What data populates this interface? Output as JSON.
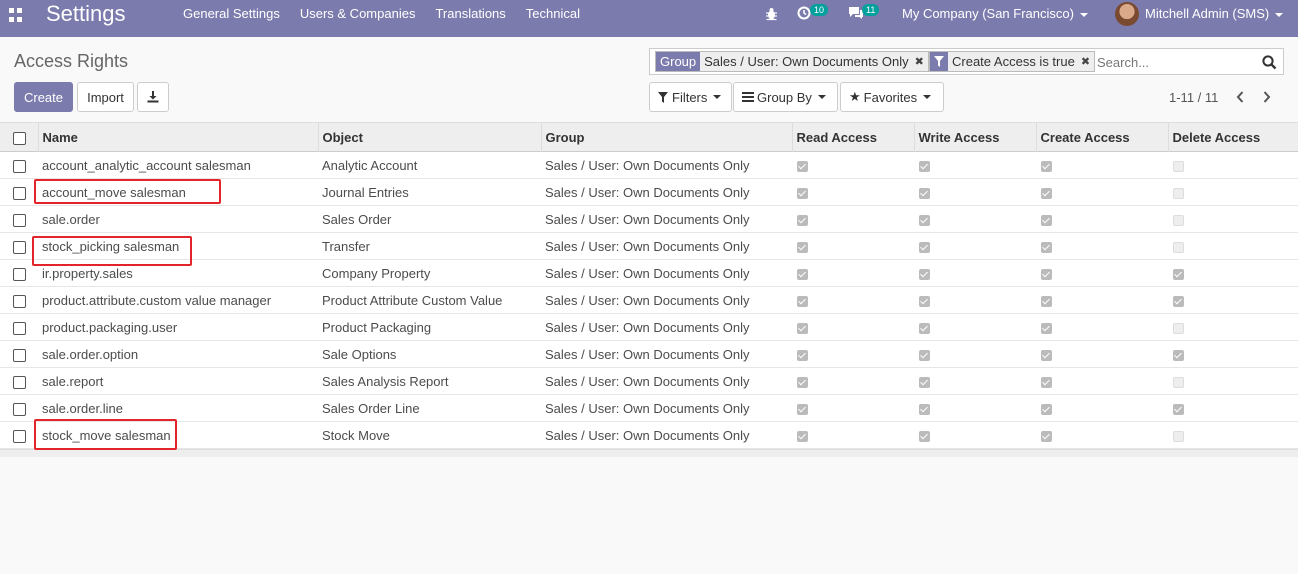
{
  "navbar": {
    "app_title": "Settings",
    "menu": [
      "General Settings",
      "Users & Companies",
      "Translations",
      "Technical"
    ],
    "activity_count": "10",
    "messages_count": "11",
    "company": "My Company (San Francisco)",
    "user": "Mitchell Admin (SMS)"
  },
  "control": {
    "breadcrumb": "Access Rights",
    "create_label": "Create",
    "import_label": "Import",
    "filters_label": "Filters",
    "groupby_label": "Group By",
    "favorites_label": "Favorites",
    "pager": "1-11 / 11"
  },
  "search": {
    "facet1_label": "Group",
    "facet1_value": "Sales / User: Own Documents Only",
    "facet2_value": "Create Access is true",
    "placeholder": "Search..."
  },
  "table": {
    "columns": [
      "Name",
      "Object",
      "Group",
      "Read Access",
      "Write Access",
      "Create Access",
      "Delete Access"
    ],
    "rows": [
      {
        "name": "account_analytic_account salesman",
        "object": "Analytic Account",
        "group": "Sales / User: Own Documents Only",
        "read": true,
        "write": true,
        "create": true,
        "delete": false
      },
      {
        "name": "account_move salesman",
        "object": "Journal Entries",
        "group": "Sales / User: Own Documents Only",
        "read": true,
        "write": true,
        "create": true,
        "delete": false
      },
      {
        "name": "sale.order",
        "object": "Sales Order",
        "group": "Sales / User: Own Documents Only",
        "read": true,
        "write": true,
        "create": true,
        "delete": false
      },
      {
        "name": "stock_picking salesman",
        "object": "Transfer",
        "group": "Sales / User: Own Documents Only",
        "read": true,
        "write": true,
        "create": true,
        "delete": false
      },
      {
        "name": "ir.property.sales",
        "object": "Company Property",
        "group": "Sales / User: Own Documents Only",
        "read": true,
        "write": true,
        "create": true,
        "delete": true
      },
      {
        "name": "product.attribute.custom value manager",
        "object": "Product Attribute Custom Value",
        "group": "Sales / User: Own Documents Only",
        "read": true,
        "write": true,
        "create": true,
        "delete": true
      },
      {
        "name": "product.packaging.user",
        "object": "Product Packaging",
        "group": "Sales / User: Own Documents Only",
        "read": true,
        "write": true,
        "create": true,
        "delete": false
      },
      {
        "name": "sale.order.option",
        "object": "Sale Options",
        "group": "Sales / User: Own Documents Only",
        "read": true,
        "write": true,
        "create": true,
        "delete": true
      },
      {
        "name": "sale.report",
        "object": "Sales Analysis Report",
        "group": "Sales / User: Own Documents Only",
        "read": true,
        "write": true,
        "create": true,
        "delete": false
      },
      {
        "name": "sale.order.line",
        "object": "Sales Order Line",
        "group": "Sales / User: Own Documents Only",
        "read": true,
        "write": true,
        "create": true,
        "delete": true
      },
      {
        "name": "stock_move salesman",
        "object": "Stock Move",
        "group": "Sales / User: Own Documents Only",
        "read": true,
        "write": true,
        "create": true,
        "delete": false
      }
    ]
  },
  "colors": {
    "navbar": "#7c7bad",
    "badge": "#00a09d",
    "highlight": "#e4242b"
  }
}
